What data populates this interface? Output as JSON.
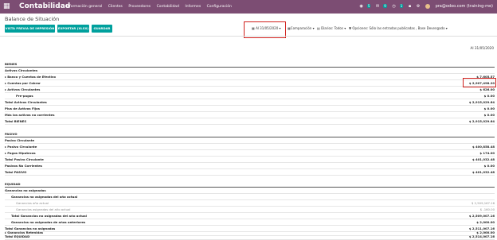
{
  "app": {
    "brand": "Contabilidad",
    "menu": [
      "Información general",
      "Clientes",
      "Proveedores",
      "Contabilidad",
      "Informes",
      "Configuración"
    ],
    "badges": [
      "5",
      "9",
      "1"
    ],
    "user": "pra@odoo.com (training-me)"
  },
  "report": {
    "title": "Balance de Situación",
    "buttons": [
      "VISTA PREVIA DE IMPRESIÓN",
      "EXPORTAR (XLSX)",
      "GUARDAR"
    ],
    "filters": {
      "date": "Al 31/05/2020",
      "comparison": "Comparación",
      "journals": "Diarios: Todos",
      "options": "Opciones: Sólo las entradas publicadas , Base Devengado"
    },
    "column_header": "Al 31/05/2020"
  },
  "rows": [
    {
      "label": "BIENES",
      "value": "",
      "kind": "section"
    },
    {
      "label": "Activos Circulantes",
      "value": "",
      "kind": "bold"
    },
    {
      "label": "Banco y Cuentas de Efectivo",
      "value": "$ 7,605.57",
      "kind": "caret"
    },
    {
      "label": "Cuentas por Cobrar",
      "value": "$ 2,907,498.20",
      "kind": "caret"
    },
    {
      "label": "Activos Circulantes",
      "value": "$ 626.00",
      "kind": "caret"
    },
    {
      "label": "Pre-pagos",
      "value": "$ 0.00",
      "kind": "indent"
    },
    {
      "label": "Total Activos Circulantes",
      "value": "$ 2,915,029.64",
      "kind": "bold"
    },
    {
      "label": "Plus de Activos Fijos",
      "value": "$ 0.00",
      "kind": "bold"
    },
    {
      "label": "Más los activos no corrientes",
      "value": "$ 0.00",
      "kind": "bold"
    },
    {
      "label": "Total BIENES",
      "value": "$ 2,915,029.64",
      "kind": "bold"
    },
    {
      "label": "PASIVO",
      "value": "",
      "kind": "section"
    },
    {
      "label": "Pasivo Circulante",
      "value": "",
      "kind": "bold"
    },
    {
      "label": "Pasivo Circulante",
      "value": "$ 400,858.48",
      "kind": "caret"
    },
    {
      "label": "Pagos Hipotecas",
      "value": "$ 174.00",
      "kind": "caret"
    },
    {
      "label": "Total Pasivo Circulante",
      "value": "$ 401,032.48",
      "kind": "bold"
    },
    {
      "label": "Pasivos No Corrientes",
      "value": "$ 0.00",
      "kind": "bold"
    },
    {
      "label": "Total PASIVO",
      "value": "$ 401,032.48",
      "kind": "bold"
    },
    {
      "label": "EQUIDAD",
      "value": "",
      "kind": "section"
    },
    {
      "label": "Ganancias no asignadas",
      "value": "",
      "kind": "bold"
    },
    {
      "label": "Ganancias no asignadas del año actual",
      "value": "",
      "kind": "bold2"
    },
    {
      "label": "Ganancias año actual",
      "value": "$ 2,509,167.16",
      "kind": "muted"
    },
    {
      "label": "Ganancias asignadas del año actual",
      "value": "$ -160.00",
      "kind": "muted"
    },
    {
      "label": "Total Ganancias no asignadas del año actual",
      "value": "$ 2,509,007.16",
      "kind": "bold2"
    },
    {
      "label": "Ganancias no asignadas de años anteriores",
      "value": "$ 2,000.00",
      "kind": "bold2"
    },
    {
      "label": "Total Ganancias no asignadas",
      "value": "$ 2,511,007.16",
      "kind": "bold"
    },
    {
      "label": "Ganancias Retenidas",
      "value": "$ 2,000.00",
      "kind": "caret"
    },
    {
      "label": "Total EQUIDAD",
      "value": "$ 2,514,007.16",
      "kind": "bold"
    }
  ]
}
